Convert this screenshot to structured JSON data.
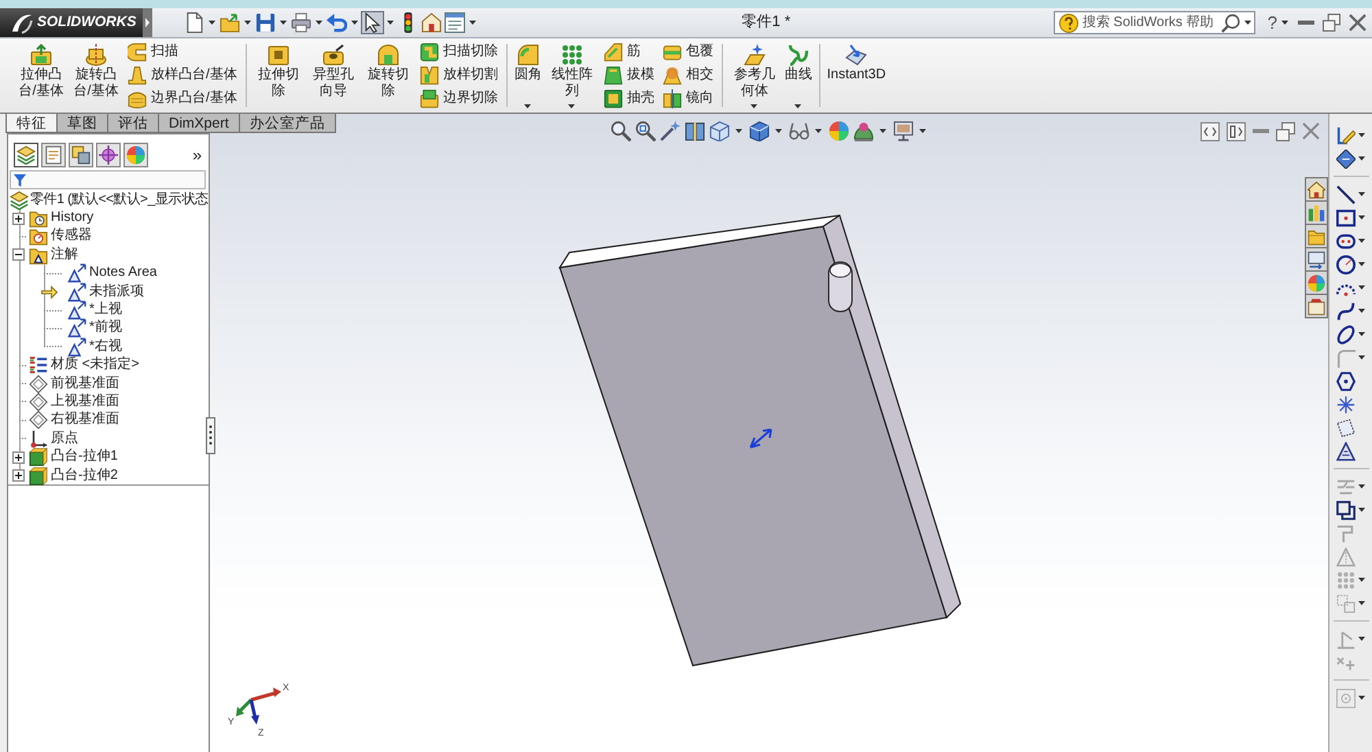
{
  "app": {
    "logo": "SOLIDWORKS",
    "title": "零件1 *"
  },
  "quick_access": [
    {
      "dropdown": true,
      "pressed": false
    },
    {
      "dropdown": true,
      "pressed": false
    },
    {
      "dropdown": true,
      "pressed": false
    },
    {
      "dropdown": true,
      "pressed": false
    },
    {
      "dropdown": true,
      "pressed": false
    },
    {
      "dropdown": true,
      "pressed": true
    },
    {
      "dropdown": false,
      "pressed": false
    },
    {
      "dropdown": false,
      "pressed": false
    },
    {
      "dropdown": true,
      "pressed": false
    }
  ],
  "search": {
    "placeholder": "搜索 SolidWorks 帮助"
  },
  "help": {
    "label": "?",
    "dropdown": true
  },
  "ribbon": {
    "groups": [
      {
        "commands": [
          {
            "kind": "large",
            "label": "拉伸凸台/基体",
            "dropdown": false
          },
          {
            "kind": "large",
            "label": "旋转凸台/基体",
            "dropdown": false
          },
          {
            "kind": "small",
            "label": "扫描",
            "dropdown": false
          },
          {
            "kind": "small",
            "label": "放样凸台/基体",
            "dropdown": false
          },
          {
            "kind": "small",
            "label": "边界凸台/基体",
            "dropdown": false
          }
        ]
      },
      {
        "commands": [
          {
            "kind": "large",
            "label": "拉伸切除",
            "dropdown": false
          },
          {
            "kind": "large",
            "label": "异型孔向导",
            "dropdown": false
          },
          {
            "kind": "large",
            "label": "旋转切除",
            "dropdown": false
          },
          {
            "kind": "small",
            "label": "扫描切除",
            "dropdown": false
          },
          {
            "kind": "small",
            "label": "放样切割",
            "dropdown": false
          },
          {
            "kind": "small",
            "label": "边界切除",
            "dropdown": false
          }
        ]
      },
      {
        "commands": [
          {
            "kind": "large",
            "label": "圆角",
            "dropdown": true
          },
          {
            "kind": "large",
            "label": "线性阵列",
            "dropdown": true
          },
          {
            "kind": "small",
            "label": "筋",
            "dropdown": false
          },
          {
            "kind": "small",
            "label": "拔模",
            "dropdown": false
          },
          {
            "kind": "small",
            "label": "抽壳",
            "dropdown": false
          },
          {
            "kind": "small",
            "label": "包覆",
            "dropdown": false
          },
          {
            "kind": "small",
            "label": "相交",
            "dropdown": false
          },
          {
            "kind": "small",
            "label": "镜向",
            "dropdown": false
          }
        ]
      },
      {
        "commands": [
          {
            "kind": "large",
            "label": "参考几何体",
            "dropdown": true
          },
          {
            "kind": "large",
            "label": "曲线",
            "dropdown": true
          }
        ]
      },
      {
        "commands": [
          {
            "kind": "large",
            "label": "Instant3D",
            "dropdown": false
          }
        ]
      }
    ]
  },
  "command_tabs": [
    {
      "label": "特征",
      "selected": true
    },
    {
      "label": "草图",
      "selected": false
    },
    {
      "label": "评估",
      "selected": false
    },
    {
      "label": "DimXpert",
      "selected": false
    },
    {
      "label": "办公室产品",
      "selected": false
    }
  ],
  "heads_up_toolbar": [
    {
      "dropdown": false
    },
    {
      "dropdown": false
    },
    {
      "dropdown": false
    },
    {
      "dropdown": false
    },
    {
      "dropdown": true
    },
    {
      "dropdown": true
    },
    {
      "dropdown": true
    },
    {
      "dropdown": false
    },
    {
      "dropdown": true
    },
    {
      "dropdown": true
    }
  ],
  "panel_tabs": [
    {
      "selected": true
    },
    {
      "selected": false
    },
    {
      "selected": false
    },
    {
      "selected": false
    },
    {
      "selected": false
    }
  ],
  "panel_more": "»",
  "feature_tree": [
    {
      "label": "零件1 (默认<<默认>_显示状态",
      "kind": "part",
      "children": [
        {
          "label": "History",
          "kind": "history",
          "expanded": false
        },
        {
          "label": "传感器",
          "kind": "sensors"
        },
        {
          "label": "注解",
          "kind": "annotations",
          "expanded": true,
          "children": [
            {
              "label": "Notes Area",
              "kind": "note",
              "active": false
            },
            {
              "label": "未指派项",
              "kind": "note",
              "active": true
            },
            {
              "label": "*上视",
              "kind": "note",
              "active": false
            },
            {
              "label": "*前视",
              "kind": "note",
              "active": false
            },
            {
              "label": "*右视",
              "kind": "note",
              "active": false
            }
          ]
        },
        {
          "label": "材质 <未指定>",
          "kind": "material"
        },
        {
          "label": "前视基准面",
          "kind": "plane"
        },
        {
          "label": "上视基准面",
          "kind": "plane"
        },
        {
          "label": "右视基准面",
          "kind": "plane"
        },
        {
          "label": "原点",
          "kind": "origin"
        },
        {
          "label": "凸台-拉伸1",
          "kind": "feature",
          "expanded": false
        },
        {
          "label": "凸台-拉伸2",
          "kind": "feature",
          "expanded": false
        }
      ]
    }
  ],
  "sketch_toolbar": {
    "groups": [
      [
        {
          "dropdown": true,
          "disabled": false
        },
        {
          "dropdown": true,
          "disabled": false
        }
      ],
      [
        {
          "dropdown": true,
          "disabled": false
        },
        {
          "dropdown": true,
          "disabled": false
        },
        {
          "dropdown": true,
          "disabled": false
        },
        {
          "dropdown": true,
          "disabled": false
        },
        {
          "dropdown": true,
          "disabled": false
        },
        {
          "dropdown": true,
          "disabled": false
        },
        {
          "dropdown": true,
          "disabled": false
        },
        {
          "dropdown": true,
          "disabled": true
        },
        {
          "dropdown": false,
          "disabled": false
        },
        {
          "dropdown": false,
          "disabled": false
        },
        {
          "dropdown": false,
          "disabled": false
        },
        {
          "dropdown": false,
          "disabled": false
        }
      ],
      [
        {
          "dropdown": true,
          "disabled": true
        },
        {
          "dropdown": true,
          "disabled": false
        },
        {
          "dropdown": false,
          "disabled": true
        },
        {
          "dropdown": false,
          "disabled": true
        },
        {
          "dropdown": true,
          "disabled": true
        },
        {
          "dropdown": true,
          "disabled": true
        }
      ],
      [
        {
          "dropdown": true,
          "disabled": true
        },
        {
          "dropdown": false,
          "disabled": true
        }
      ],
      [
        {
          "dropdown": true,
          "disabled": true
        }
      ]
    ]
  },
  "triad": {
    "axes": [
      "X",
      "Y",
      "Z"
    ]
  }
}
